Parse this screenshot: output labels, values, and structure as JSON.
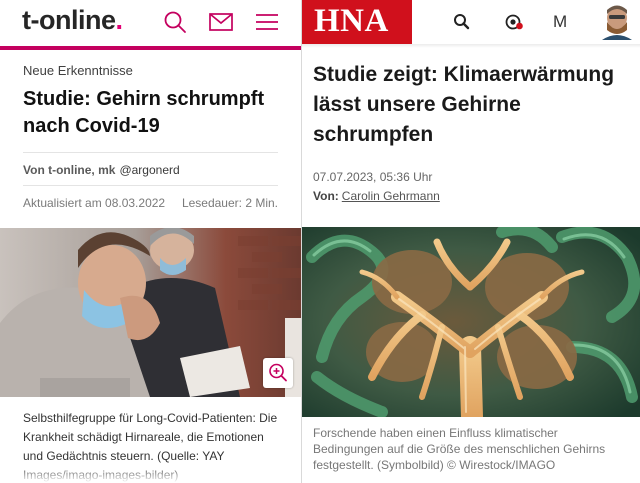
{
  "tonline": {
    "logo_text": "t-online",
    "logo_dot": ".",
    "brand_color": "#e20074",
    "bar_color": "#c4005f",
    "icons": [
      "search-icon",
      "mail-icon",
      "menu-icon"
    ],
    "kicker": "Neue Erkenntnisse",
    "headline": "Studie: Gehirn schrumpft nach Covid-19",
    "author_label": "Von t-online, mk",
    "author_handle": "@argonerd",
    "updated": "Aktualisiert am 08.03.2022",
    "read_time": "Lesedauer: 2 Min.",
    "image_icon": "zoom-in-icon",
    "caption": "Selbsthilfegruppe für Long-Covid-Patienten: Die Krankheit schädigt Hirnareale, die Emotionen und Gedächtnis steuern. (Quelle: YAY Images/imago-images-bilder)"
  },
  "hna": {
    "logo_text": "HNA",
    "brand_color": "#d0101c",
    "icons": [
      "search-icon",
      "signal-icon",
      "m-icon",
      "avatar"
    ],
    "m_label": "M",
    "headline": "Studie zeigt: Klimaerwärmung lässt unsere Gehirne schrumpfen",
    "date": "07.07.2023, 05:36 Uhr",
    "byline_label": "Von:",
    "author": "Carolin Gehrmann",
    "caption": "Forschende haben einen Einfluss klimatischer Bedingungen auf die Größe des menschlichen Gehirns festgestellt. (Symbolbild) © Wirestock/IMAGO"
  }
}
